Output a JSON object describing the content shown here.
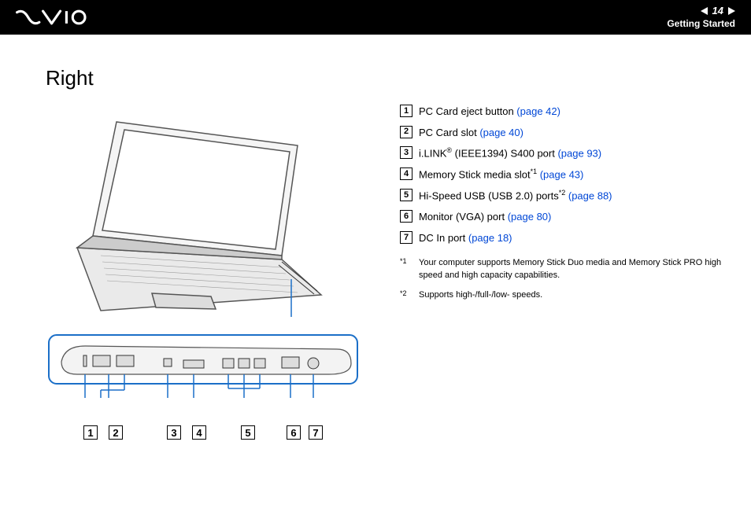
{
  "header": {
    "page_number": "14",
    "section": "Getting Started"
  },
  "title": "Right",
  "items": [
    {
      "num": "1",
      "text": "PC Card eject button ",
      "link": "(page 42)"
    },
    {
      "num": "2",
      "text": "PC Card slot ",
      "link": "(page 40)"
    },
    {
      "num": "3",
      "text_pre": "i.LINK",
      "reg": "®",
      "text_post": " (IEEE1394) S400 port ",
      "link": "(page 93)"
    },
    {
      "num": "4",
      "text": "Memory Stick media slot",
      "sup": "*1",
      "link": " (page 43)"
    },
    {
      "num": "5",
      "text": "Hi-Speed USB (USB 2.0) ports",
      "sup": "*2",
      "link": " (page 88)"
    },
    {
      "num": "6",
      "text": "Monitor (VGA) port ",
      "link": "(page 80)"
    },
    {
      "num": "7",
      "text": "DC In port ",
      "link": "(page 18)"
    }
  ],
  "footnotes": [
    {
      "mark": "*1",
      "text": "Your computer supports Memory Stick Duo media and Memory Stick PRO high speed and high capacity capabilities."
    },
    {
      "mark": "*2",
      "text": "Supports high-/full-/low- speeds."
    }
  ],
  "callouts": [
    "1",
    "2",
    "3",
    "4",
    "5",
    "6",
    "7"
  ]
}
